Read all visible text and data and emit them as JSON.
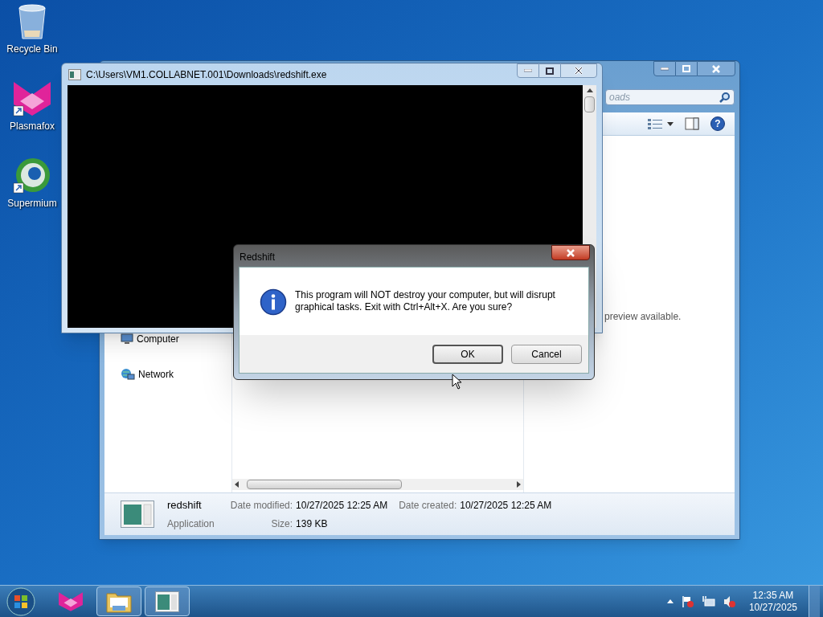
{
  "desktop_icons": [
    {
      "label": "Recycle Bin",
      "kind": "bin"
    },
    {
      "label": "Plasmafox",
      "kind": "fox"
    },
    {
      "label": "Supermium",
      "kind": "globe"
    }
  ],
  "explorer": {
    "search": {
      "placeholder": "oads"
    },
    "nav_items": [
      {
        "label": "Computer",
        "kind": "computer"
      },
      {
        "label": "Network",
        "kind": "network"
      }
    ],
    "help_glyph": "?",
    "preview_message": "preview available.",
    "details": {
      "name": "redshift",
      "type": "Application",
      "fields": [
        {
          "label": "Date modified:",
          "value": "10/27/2025 12:25 AM"
        },
        {
          "label": "Date created:",
          "value": "10/27/2025 12:25 AM"
        },
        {
          "label": "Size:",
          "value": "139 KB"
        }
      ]
    }
  },
  "console": {
    "title": "C:\\Users\\VM1.COLLABNET.001\\Downloads\\redshift.exe"
  },
  "dialog": {
    "title": "Redshift",
    "message": "This program will NOT destroy your computer, but will disrupt graphical tasks. Exit with Ctrl+Alt+X. Are you sure?",
    "buttons": [
      {
        "label": "OK",
        "selected": true
      },
      {
        "label": "Cancel",
        "selected": false
      }
    ]
  },
  "taskbar": {
    "items": [
      {
        "kind": "fox",
        "open": false
      },
      {
        "kind": "folder",
        "open": true
      },
      {
        "kind": "app",
        "open": true
      }
    ],
    "time": "12:35 AM",
    "date": "10/27/2025"
  }
}
